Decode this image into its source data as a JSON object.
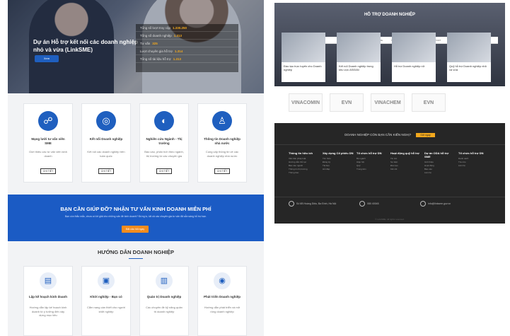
{
  "left_page": {
    "hero": {
      "title": "Dự án Hỗ trợ kết nối các doanh nghiệp nhỏ và vừa (LinkSME)",
      "button": "Xem",
      "stats": [
        {
          "label": "Tổng số lượt truy cập",
          "value": "1.330.250"
        },
        {
          "label": "Tổng số doanh nghiệp",
          "value": "1.313"
        },
        {
          "label": "Tư vấn",
          "value": "325"
        },
        {
          "label": "Lượt chuyên gia hỗ trợ",
          "value": "1.314"
        },
        {
          "label": "Tổng số tài liệu hỗ trợ",
          "value": "1.313"
        }
      ]
    },
    "services": [
      {
        "title": "Mạng lưới tư vấn viên SME",
        "desc": "Giới thiệu các tư vấn viên kinh doanh",
        "button": "CHI TIẾT",
        "icon": "network-icon"
      },
      {
        "title": "Kết nối Doanh nghiệp",
        "desc": "Kết nối các doanh nghiệp trên toàn quốc",
        "button": "CHI TIẾT",
        "icon": "globe-icon"
      },
      {
        "title": "Nghiên cứu Ngành - Thị trường",
        "desc": "Báo cáo, phân tích theo ngành, thị trường từ các chuyên gia",
        "button": "CHI TIẾT",
        "icon": "chart-icon"
      },
      {
        "title": "Thông tin Doanh nghiệp nhà nước",
        "desc": "Cung cấp thông tin về các doanh nghiệp nhà nước",
        "button": "CHI TIẾT",
        "icon": "building-user-icon"
      }
    ],
    "band": {
      "title": "BẠN CẦN GIÚP ĐỠ? NHẬN TƯ VẤN KINH DOANH MIỄN PHÍ",
      "desc": "Bạn còn thắc mắc, chưa có lời giải cho những vấn đề kinh doanh? Đừng lo, tất cả các chuyên gia tư vấn đã sẵn sàng hỗ trợ bạn.",
      "button": "Đặt câu hỏi ngay"
    },
    "guide": {
      "title": "HƯỚNG DẪN DOANH NGHIỆP",
      "items": [
        {
          "title": "Lập kế hoạch kinh doanh",
          "desc": "Hướng dẫn lập kế hoạch kinh doanh từ ý tưởng đến xây dựng mục tiêu",
          "icon": "plan-icon"
        },
        {
          "title": "Khởi nghiệp - Bạn có",
          "desc": "Cẩm nang cần thiết cho người khởi nghiệp",
          "icon": "rocket-icon"
        },
        {
          "title": "Quản trị Doanh nghiệp",
          "desc": "Các chuyên đề kỹ năng quản trị doanh nghiệp",
          "icon": "manage-icon"
        },
        {
          "title": "Phát triển Doanh nghiệp",
          "desc": "Hướng dẫn phát triển và mở rộng doanh nghiệp",
          "icon": "growth-icon"
        }
      ]
    }
  },
  "right_page": {
    "title": "HỖ TRỢ DOANH NGHIỆP",
    "logo": "LinkSME",
    "nav": [
      "NEWS · EVENTS",
      "LINKSME",
      "SMES · EXPERTISE",
      "BIG SUPPORT",
      "MARKET INSIGHTS"
    ],
    "cards": [
      "Đào tạo trực tuyến cho Doanh nghiệp",
      "Kết nối Doanh nghiệp trong khu vực ASEAN",
      "Hỗ trợ Doanh nghiệp nữ",
      "Quỹ hỗ trợ Doanh nghiệp nhỏ và vừa"
    ],
    "partners": [
      "VINACOMIN",
      "EVN",
      "VINACHEM",
      "EVN"
    ],
    "footer": {
      "question": "DOANH NGHIỆP CÓN BẠN CẦN KIẾN NGHỊ?",
      "question_btn": "Gửi ngay",
      "columns": [
        {
          "head": "Thông tin hữu ích",
          "items": [
            "Văn bản pháp luật",
            "Hướng dẫn thủ tục",
            "Báo cáo ngành",
            "Thông tin thị trường",
            "Thông báo"
          ]
        },
        {
          "head": "Xây dựng Cổ phiếu DN",
          "items": [
            "Tìm hiểu",
            "Đăng ký",
            "Tài liệu",
            "Hỏi đáp"
          ]
        },
        {
          "head": "Tổ chức hỗ trợ DN",
          "items": [
            "Bộ ngành",
            "Hiệp hội",
            "Quỹ",
            "Trung tâm"
          ]
        },
        {
          "head": "Hoạt động quỹ hỗ trợ",
          "items": [
            "Tin tức",
            "Sự kiện",
            "Đào tạo",
            "Kết nối"
          ]
        },
        {
          "head": "Dự án ODA hỗ trợ SME",
          "items": [
            "Giới thiệu",
            "Hoạt động",
            "Báo cáo",
            "Liên hệ"
          ]
        },
        {
          "head": "Tổ chức hỗ trợ DN",
          "items": [
            "Danh sách",
            "Tra cứu",
            "Liên hệ"
          ]
        }
      ],
      "address": "Số 6B Hoàng Diệu, Ba Đình, Hà Nội",
      "phone": "080 40045",
      "email": "info@linksme.gov.vn",
      "copyright": "© LinkSME. All rights reserved."
    }
  }
}
